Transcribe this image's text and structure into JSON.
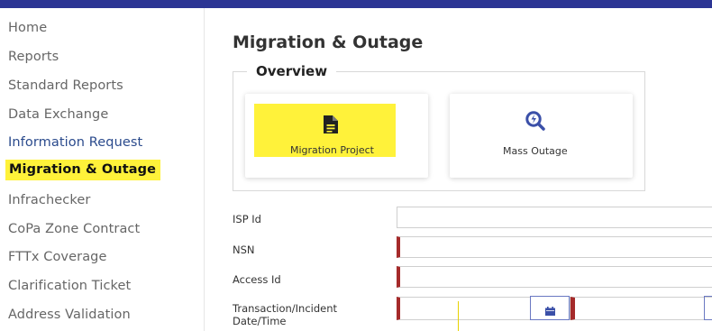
{
  "sidebar": {
    "items": [
      {
        "label": "Home"
      },
      {
        "label": "Reports"
      },
      {
        "label": "Standard Reports"
      },
      {
        "label": "Data Exchange"
      },
      {
        "label": "Information Request"
      },
      {
        "label": "Migration & Outage"
      },
      {
        "label": "Infrachecker"
      },
      {
        "label": "CoPa Zone Contract"
      },
      {
        "label": "FTTx Coverage"
      },
      {
        "label": "Clarification Ticket"
      },
      {
        "label": "Address Validation"
      }
    ],
    "active_item": "Migration & Outage"
  },
  "main": {
    "title": "Migration & Outage",
    "overview": {
      "legend": "Overview",
      "cards": [
        {
          "label": "Migration Project",
          "icon": "document-icon"
        },
        {
          "label": "Mass Outage",
          "icon": "outage-search-icon"
        }
      ]
    },
    "form": {
      "fields": [
        {
          "label": "ISP Id",
          "value": ""
        },
        {
          "label": "NSN",
          "value": ""
        },
        {
          "label": "Access Id",
          "value": ""
        }
      ],
      "datetime": {
        "label_line1": "Transaction/Incident",
        "label_line2": "Date/Time"
      }
    }
  },
  "colors": {
    "topbar": "#2c3594",
    "highlight": "#fff23a",
    "required": "#a52a2a",
    "accent": "#3a4fa8"
  }
}
